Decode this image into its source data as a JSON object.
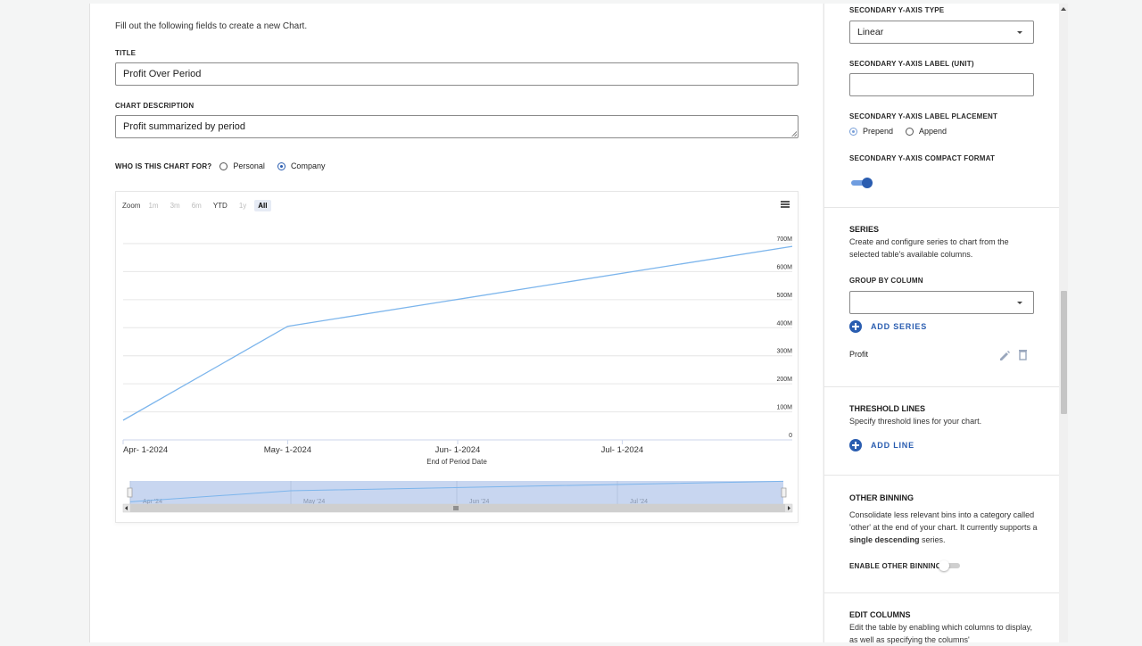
{
  "form": {
    "intro": "Fill out the following fields to create a new Chart.",
    "title_label": "TITLE",
    "title_value": "Profit Over Period",
    "description_label": "CHART DESCRIPTION",
    "description_value": "Profit summarized by period",
    "audience_label": "WHO IS THIS CHART FOR?",
    "audience_options": [
      {
        "label": "Personal",
        "selected": false
      },
      {
        "label": "Company",
        "selected": true
      }
    ]
  },
  "chart_toolbar": {
    "zoom_label": "Zoom",
    "zoom_options": [
      {
        "label": "1m",
        "state": "disabled"
      },
      {
        "label": "3m",
        "state": "disabled"
      },
      {
        "label": "6m",
        "state": "disabled"
      },
      {
        "label": "YTD",
        "state": "enabled"
      },
      {
        "label": "1y",
        "state": "disabled"
      },
      {
        "label": "All",
        "state": "active"
      }
    ],
    "menu_icon": "hamburger-menu-icon"
  },
  "chart_data": {
    "type": "line",
    "title": "",
    "xlabel": "End of Period Date",
    "ylabel": "",
    "x_tick_labels": [
      "Apr- 1-2024",
      "May- 1-2024",
      "Jun- 1-2024",
      "Jul- 1-2024"
    ],
    "y_tick_labels": [
      "0",
      "100M",
      "200M",
      "300M",
      "400M",
      "500M",
      "600M",
      "700M"
    ],
    "ylim": [
      0,
      700
    ],
    "y_unit": "M",
    "series": [
      {
        "name": "Profit",
        "color": "#7cb5ec",
        "x": [
          "2024-04-01",
          "2024-05-01",
          "2024-08-01"
        ],
        "y": [
          70,
          405,
          690
        ]
      }
    ],
    "navigator": {
      "labels": [
        "Apr '24",
        "May '24",
        "Jun '24",
        "Jul '24"
      ]
    },
    "legend": "none",
    "grid": true
  },
  "right": {
    "y2_type_label": "SECONDARY Y-AXIS TYPE",
    "y2_type_value": "Linear",
    "y2_unit_label": "SECONDARY Y-AXIS LABEL (UNIT)",
    "y2_placement_label": "SECONDARY Y-AXIS LABEL PLACEMENT",
    "y2_placement_options": [
      {
        "label": "Prepend",
        "selected": true
      },
      {
        "label": "Append",
        "selected": false
      }
    ],
    "y2_compact_label": "SECONDARY Y-AXIS COMPACT FORMAT",
    "y2_compact_on": true,
    "series_title": "SERIES",
    "series_desc": "Create and configure series to chart from the selected table's available columns.",
    "group_by_label": "GROUP BY COLUMN",
    "add_series_label": "ADD SERIES",
    "series_items": [
      {
        "name": "Profit"
      }
    ],
    "threshold_title": "THRESHOLD LINES",
    "threshold_desc": "Specify threshold lines for your chart.",
    "add_line_label": "ADD LINE",
    "binning_title": "OTHER BINNING",
    "binning_desc_pre": "Consolidate less relevant bins into a category called 'other' at the end of your chart. It currently supports a ",
    "binning_desc_bold": "single descending",
    "binning_desc_post": " series.",
    "binning_toggle_label": "ENABLE OTHER BINNING?",
    "binning_on": false,
    "edit_columns_title": "EDIT COLUMNS",
    "edit_columns_desc": "Edit the table by enabling which columns to display, as well as specifying the columns'"
  },
  "colors": {
    "accent": "#2a5db0",
    "line": "#7cb5ec",
    "toggle_track_on": "#6f9de0"
  }
}
